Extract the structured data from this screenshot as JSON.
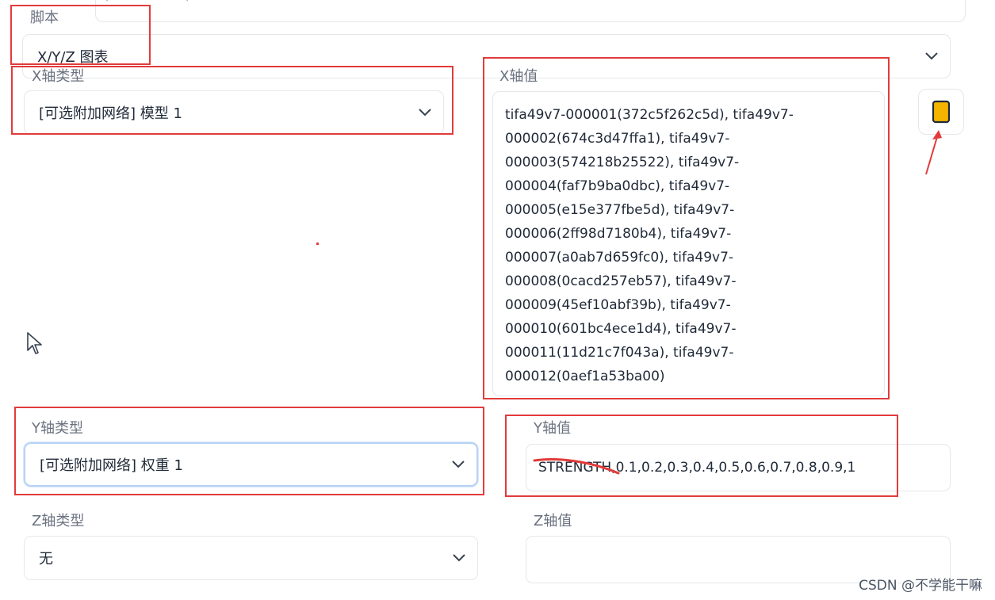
{
  "top_partial": {
    "text": "(... ... ... ... ...)"
  },
  "script": {
    "label": "脚本",
    "selected": "X/Y/Z 图表"
  },
  "x_axis": {
    "type_label": "X轴类型",
    "type_selected": "[可选附加网络] 模型 1",
    "values_label": "X轴值",
    "values_lines": [
      "tifa49v7-000001(372c5f262c5d), tifa49v7-",
      "000002(674c3d47ffa1), tifa49v7-",
      "000003(574218b25522), tifa49v7-",
      "000004(faf7b9ba0dbc), tifa49v7-",
      "000005(e15e377fbe5d), tifa49v7-",
      "000006(2ff98d7180b4), tifa49v7-",
      "000007(a0ab7d659fc0), tifa49v7-",
      "000008(0cacd257eb57), tifa49v7-",
      "000009(45ef10abf39b), tifa49v7-",
      "000010(601bc4ece1d4), tifa49v7-",
      "000011(11d21c7f043a), tifa49v7-",
      "000012(0aef1a53ba00)"
    ]
  },
  "y_axis": {
    "type_label": "Y轴类型",
    "type_selected": "[可选附加网络] 权重 1",
    "values_label": "Y轴值",
    "values": "STRENGTH,0.1,0.2,0.3,0.4,0.5,0.6,0.7,0.8,0.9,1"
  },
  "z_axis": {
    "type_label": "Z轴类型",
    "type_selected": "无",
    "values_label": "Z轴值",
    "values": ""
  },
  "fill_button": {
    "icon": "yellow-card-icon",
    "color": "#f5b400"
  },
  "watermark": "CSDN @不学能干嘛",
  "colors": {
    "annotation": "#e23b3b",
    "border": "#e5e7eb",
    "focus": "#b7d4f5"
  }
}
